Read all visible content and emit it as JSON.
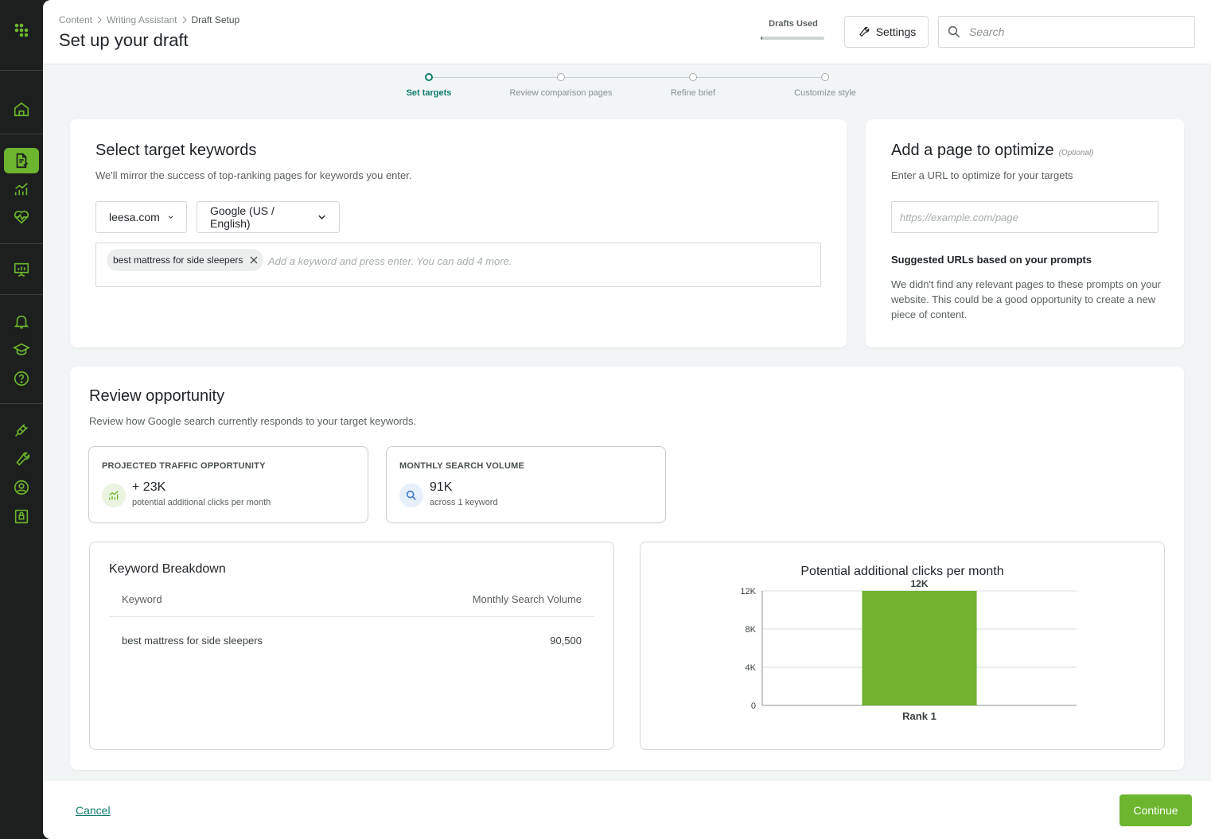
{
  "header": {
    "breadcrumb": [
      "Content",
      "Writing Assistant",
      "Draft Setup"
    ],
    "title": "Set up your draft",
    "drafts_used_label": "Drafts Used",
    "drafts_used_progress": 0.02,
    "settings_label": "Settings",
    "search_placeholder": "Search"
  },
  "stepper": {
    "steps": [
      {
        "label": "Set targets",
        "active": true
      },
      {
        "label": "Review comparison pages",
        "active": false
      },
      {
        "label": "Refine brief",
        "active": false
      },
      {
        "label": "Customize style",
        "active": false
      }
    ]
  },
  "keywords_card": {
    "title": "Select target keywords",
    "subtitle": "We'll mirror the success of top-ranking pages for keywords you enter.",
    "domain": "leesa.com",
    "engine": "Google (US / English)",
    "chips": [
      "best mattress for side sleepers"
    ],
    "input_placeholder": "Add a keyword and press enter. You can add 4 more."
  },
  "optimize_card": {
    "title": "Add a page to optimize",
    "optional": "(Optional)",
    "subtitle": "Enter a URL to optimize for your targets",
    "url_placeholder": "https://example.com/page",
    "suggested_title": "Suggested URLs based on your prompts",
    "suggested_text": "We didn't find any relevant pages to these prompts on your website. This could be a good opportunity to create a new piece of content."
  },
  "opportunity": {
    "title": "Review opportunity",
    "subtitle": "Review how Google search currently responds to your target keywords.",
    "metrics": [
      {
        "label": "PROJECTED TRAFFIC OPPORTUNITY",
        "value": "+ 23K",
        "desc": "potential additional clicks per month",
        "icon": "traffic-chart-icon"
      },
      {
        "label": "MONTHLY SEARCH VOLUME",
        "value": "91K",
        "desc": "across 1 keyword",
        "icon": "search-icon"
      }
    ],
    "breakdown": {
      "title": "Keyword Breakdown",
      "columns": [
        "Keyword",
        "Monthly Search Volume"
      ],
      "rows": [
        [
          "best mattress for side sleepers",
          "90,500"
        ]
      ]
    }
  },
  "chart_data": {
    "type": "bar",
    "title": "Potential additional clicks per month",
    "categories": [
      "Rank 1"
    ],
    "values": [
      12000
    ],
    "data_labels": [
      "12K"
    ],
    "yticks": [
      0,
      4000,
      8000,
      12000
    ],
    "ytick_labels": [
      "0",
      "4K",
      "8K",
      "12K"
    ],
    "ylim": [
      0,
      12000
    ],
    "grid": true,
    "bar_color": "#72b22f"
  },
  "footer": {
    "cancel_label": "Cancel",
    "continue_label": "Continue"
  },
  "colors": {
    "brand_green": "#6db52e",
    "accent_teal": "#0f7b6c",
    "sidebar_bg": "#1c1f1e"
  }
}
